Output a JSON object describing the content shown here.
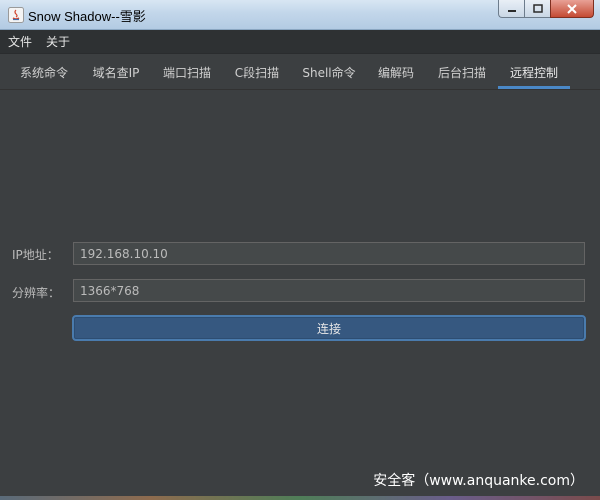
{
  "window": {
    "title": "Snow Shadow--雪影"
  },
  "menu": {
    "items": [
      "文件",
      "关于"
    ]
  },
  "tabs": [
    {
      "label": "系统命令",
      "active": false
    },
    {
      "label": "域名查IP",
      "active": false
    },
    {
      "label": "端口扫描",
      "active": false
    },
    {
      "label": "C段扫描",
      "active": false
    },
    {
      "label": "Shell命令",
      "active": false
    },
    {
      "label": "编解码",
      "active": false
    },
    {
      "label": "后台扫描",
      "active": false
    },
    {
      "label": "远程控制",
      "active": true
    }
  ],
  "form": {
    "ip_label": "IP地址：",
    "ip_value": "192.168.10.10",
    "resolution_label": "分辨率：",
    "resolution_value": "1366*768",
    "connect_label": "连接"
  },
  "watermark": "安全客（www.anquanke.com）",
  "colors": {
    "accent": "#4a88c7",
    "button": "#365880",
    "background": "#3c3f41"
  }
}
